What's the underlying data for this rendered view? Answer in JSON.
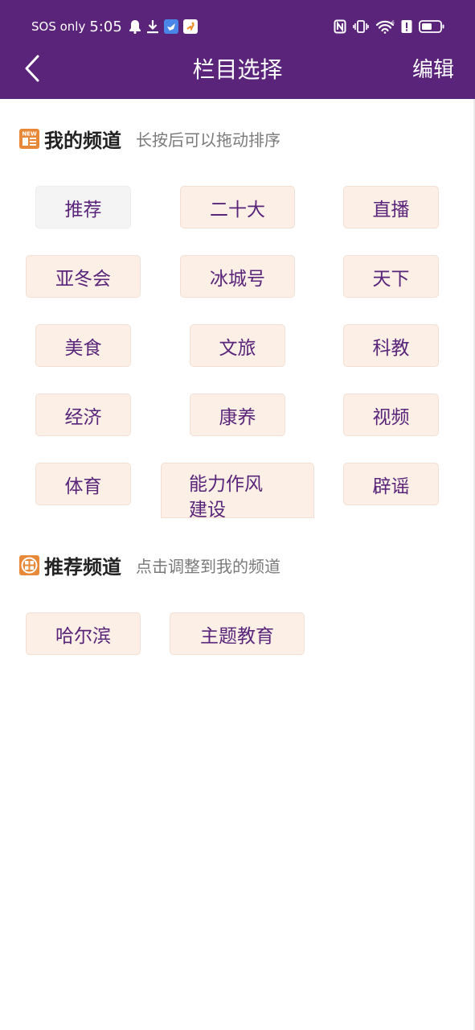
{
  "status_bar": {
    "sos": "SOS only",
    "time": "5:05"
  },
  "nav": {
    "title": "栏目选择",
    "edit_label": "编辑"
  },
  "my_channels": {
    "title": "我的频道",
    "hint": "长按后可以拖动排序",
    "icon_text": "NEW",
    "items": [
      {
        "label": "推荐",
        "selected": true
      },
      {
        "label": "二十大"
      },
      {
        "label": "直播"
      },
      {
        "label": "亚冬会"
      },
      {
        "label": "冰城号"
      },
      {
        "label": "天下"
      },
      {
        "label": "美食"
      },
      {
        "label": "文旅"
      },
      {
        "label": "科教"
      },
      {
        "label": "经济"
      },
      {
        "label": "康养"
      },
      {
        "label": "视频"
      },
      {
        "label": "体育"
      },
      {
        "label": "能力作风建设"
      },
      {
        "label": "辟谣"
      }
    ]
  },
  "recommended_channels": {
    "title": "推荐频道",
    "hint": "点击调整到我的频道",
    "items": [
      {
        "label": "哈尔滨"
      },
      {
        "label": "主题教育"
      }
    ]
  },
  "colors": {
    "brand_purple": "#5a247b",
    "chip_bg": "#fbefe6",
    "section_icon_orange": "#e8893a"
  },
  "icons": {
    "back": "chevron-left-icon",
    "my_channels": "new-badge-icon",
    "recommended_channels": "grid-badge-icon"
  }
}
